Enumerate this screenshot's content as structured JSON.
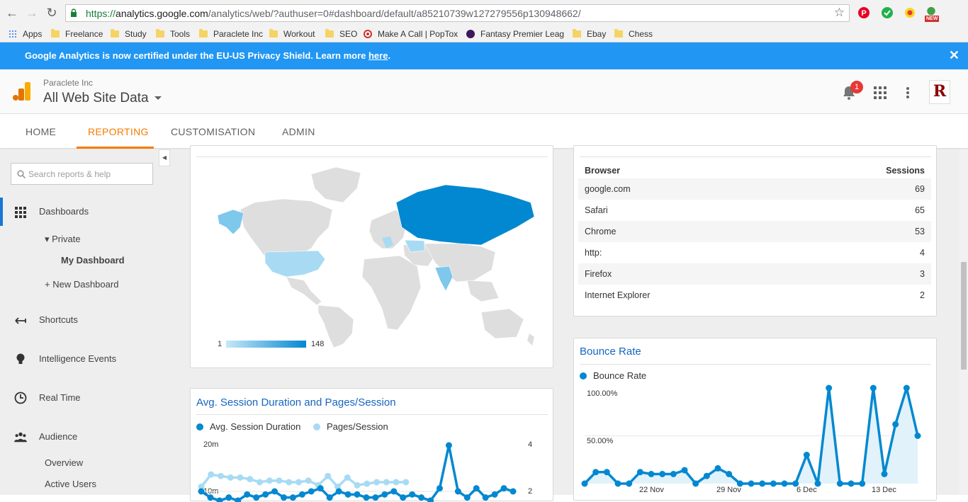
{
  "browser": {
    "url_proto": "https://",
    "url_host": "analytics.google.com",
    "url_path": "/analytics/web/?authuser=0#dashboard/default/a85210739w127279556p130948662/",
    "ext_new_badge": "NEW",
    "bookmarks": [
      {
        "label": "Apps",
        "icon": "apps-grid-icon"
      },
      {
        "label": "Freelance",
        "icon": "folder-icon"
      },
      {
        "label": "Study",
        "icon": "folder-icon"
      },
      {
        "label": "Tools",
        "icon": "folder-icon"
      },
      {
        "label": "Paraclete Inc",
        "icon": "folder-icon"
      },
      {
        "label": "Workout",
        "icon": "folder-icon"
      },
      {
        "label": "SEO",
        "icon": "folder-icon"
      },
      {
        "label": "Make A Call | PopTox",
        "icon": "target-icon"
      },
      {
        "label": "Fantasy Premier Leag",
        "icon": "premier-league-icon"
      },
      {
        "label": "Ebay",
        "icon": "folder-icon"
      },
      {
        "label": "Chess",
        "icon": "folder-icon"
      }
    ]
  },
  "banner": {
    "text": "Google Analytics is now certified under the EU-US Privacy Shield. Learn more ",
    "link": "here",
    "after": ".",
    "close": "✕"
  },
  "header": {
    "account": "Paraclete Inc",
    "property": "All Web Site Data",
    "notifications": "1",
    "avatar_letter": "R"
  },
  "tabs": [
    {
      "label": "HOME",
      "active": false
    },
    {
      "label": "REPORTING",
      "active": true
    },
    {
      "label": "CUSTOMISATION",
      "active": false
    },
    {
      "label": "ADMIN",
      "active": false
    }
  ],
  "sidebar": {
    "search_placeholder": "Search reports & help",
    "dashboards": "Dashboards",
    "private": "▾ Private",
    "my_dashboard": "My Dashboard",
    "new_dashboard": "+ New Dashboard",
    "shortcuts": "Shortcuts",
    "intelligence": "Intelligence Events",
    "realtime": "Real Time",
    "audience": "Audience",
    "overview": "Overview",
    "active_users": "Active Users"
  },
  "map_card": {
    "legend_min": "1",
    "legend_max": "148"
  },
  "browser_table": {
    "col_browser": "Browser",
    "col_sessions": "Sessions",
    "rows": [
      {
        "browser": "google.com",
        "sessions": "69"
      },
      {
        "browser": "Safari",
        "sessions": "65"
      },
      {
        "browser": "Chrome",
        "sessions": "53"
      },
      {
        "browser": "http:",
        "sessions": "4"
      },
      {
        "browser": "Firefox",
        "sessions": "3"
      },
      {
        "browser": "Internet Explorer",
        "sessions": "2"
      }
    ]
  },
  "duration_card": {
    "title": "Avg. Session Duration and Pages/Session",
    "series1": "Avg. Session Duration",
    "series2": "Pages/Session",
    "y_left_top": "20m",
    "y_left_mid": "10m",
    "y_right_top": "4",
    "y_right_mid": "2"
  },
  "bounce_card": {
    "title": "Bounce Rate",
    "series": "Bounce Rate",
    "y_top": "100.00%",
    "y_mid": "50.00%",
    "x_labels": [
      "22 Nov",
      "29 Nov",
      "6 Dec",
      "13 Dec"
    ]
  },
  "chart_data": [
    {
      "type": "line",
      "title": "Bounce Rate",
      "series": [
        {
          "name": "Bounce Rate",
          "values": [
            0,
            12,
            12,
            0,
            0,
            12,
            10,
            10,
            10,
            14,
            0,
            8,
            16,
            10,
            0,
            0,
            0,
            0,
            0,
            0,
            30,
            0,
            100,
            0,
            0,
            0,
            100,
            10,
            62,
            100,
            50
          ]
        }
      ],
      "ylim": [
        0,
        100
      ],
      "y_ticks": [
        "50.00%",
        "100.00%"
      ],
      "x_ticks": [
        "22 Nov",
        "29 Nov",
        "6 Dec",
        "13 Dec"
      ],
      "color": "#0288d1"
    },
    {
      "type": "line",
      "title": "Avg. Session Duration and Pages/Session",
      "series": [
        {
          "name": "Avg. Session Duration",
          "values": [
            5,
            3,
            2,
            3,
            2,
            4,
            3,
            4,
            5,
            3,
            3,
            4,
            5,
            6,
            3,
            5,
            4,
            4,
            3,
            3,
            4,
            5,
            3,
            4,
            3,
            2,
            6,
            20,
            5,
            3,
            6,
            3,
            4,
            6,
            5
          ]
        },
        {
          "name": "Pages/Session",
          "values": [
            1.3,
            2.1,
            2.0,
            1.9,
            1.9,
            1.8,
            1.6,
            1.7,
            1.7,
            1.6,
            1.6,
            1.7,
            1.4,
            2.0,
            1.3,
            1.9,
            1.4,
            1.5,
            1.6,
            1.6,
            1.6,
            1.6
          ]
        }
      ],
      "y_left_ticks": [
        "10m",
        "20m"
      ],
      "y_right_ticks": [
        "2",
        "4"
      ]
    }
  ]
}
